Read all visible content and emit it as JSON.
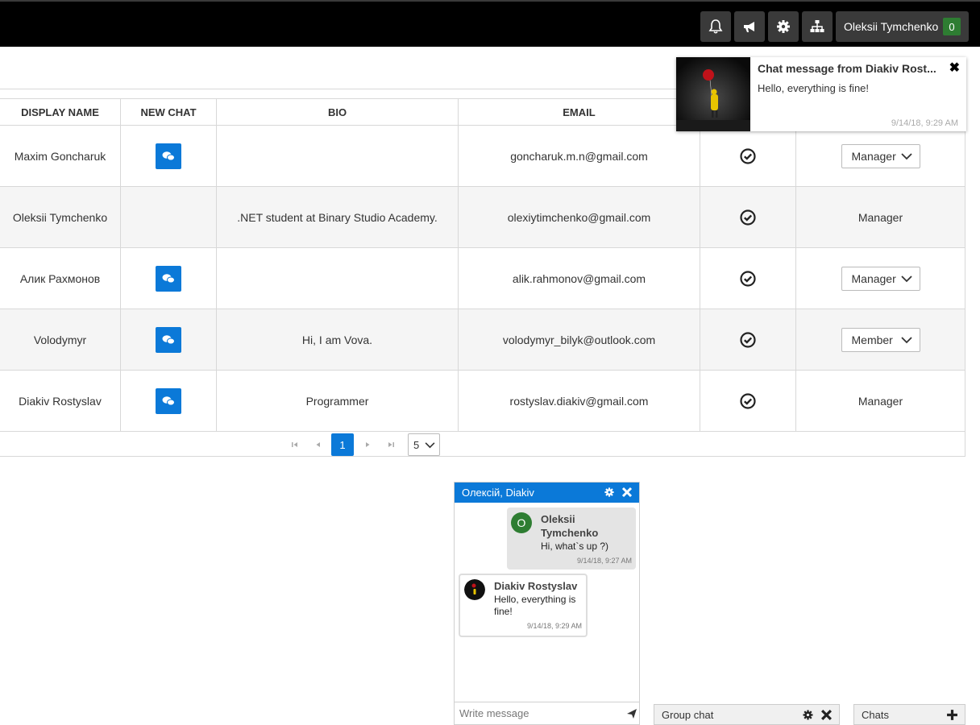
{
  "header": {
    "user_name": "Oleksii Tymchenko",
    "user_count": "0",
    "icons": [
      "bell-icon",
      "megaphone-icon",
      "gear-icon",
      "sitemap-icon"
    ]
  },
  "table": {
    "columns": [
      "DISPLAY NAME",
      "NEW CHAT",
      "BIO",
      "EMAIL"
    ],
    "rows": [
      {
        "name": "Maxim Goncharuk",
        "chat": true,
        "bio": "",
        "email": "goncharuk.m.n@gmail.com",
        "role": "Manager",
        "role_editable": true
      },
      {
        "name": "Oleksii Tymchenko",
        "chat": false,
        "bio": ".NET student at Binary Studio Academy.",
        "email": "olexiytimchenko@gmail.com",
        "role": "Manager",
        "role_editable": false
      },
      {
        "name": "Алик Рахмонов",
        "chat": true,
        "bio": "",
        "email": "alik.rahmonov@gmail.com",
        "role": "Manager",
        "role_editable": true
      },
      {
        "name": "Volodymyr",
        "chat": true,
        "bio": "Hi, I am Vova.",
        "email": "volodymyr_bilyk@outlook.com",
        "role": "Member",
        "role_editable": true
      },
      {
        "name": "Diakiv Rostyslav",
        "chat": true,
        "bio": "Programmer",
        "email": "rostyslav.diakiv@gmail.com",
        "role": "Manager",
        "role_editable": false
      }
    ]
  },
  "pager": {
    "current_page": "1",
    "page_size": "5"
  },
  "notification": {
    "title": "Chat message from Diakiv Rost...",
    "text": "Hello, everything is fine!",
    "time": "9/14/18, 9:29 AM",
    "close": "✖"
  },
  "chat": {
    "title": "Олексій, Diakiv",
    "messages": [
      {
        "author_line1": "Oleksii",
        "author_line2": "Tymchenko",
        "avatar_letter": "O",
        "text": "Hi, what`s up ?)",
        "time": "9/14/18, 9:27 AM"
      },
      {
        "author": "Diakiv Rostyslav",
        "text_line1": "Hello, everything is",
        "text_line2": "fine!",
        "time": "9/14/18, 9:29 AM"
      }
    ],
    "input_placeholder": "Write message"
  },
  "bottom_tabs": {
    "group_chat": "Group chat",
    "chats": "Chats"
  },
  "colors": {
    "accent": "#0b79d8",
    "topbar": "#000000",
    "badge": "#2e7d32"
  }
}
